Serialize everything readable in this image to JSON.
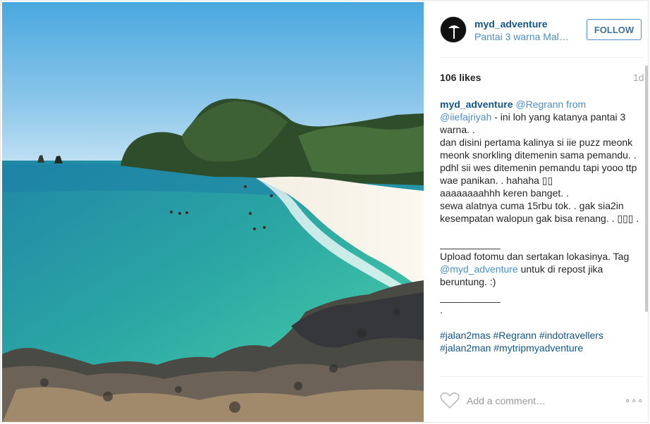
{
  "post": {
    "username": "myd_adventure",
    "location": "Pantai 3 warna Mal…",
    "follow_label": "FOLLOW",
    "likes": "106 likes",
    "time_ago": "1d",
    "caption_lines": [
      "@Regrann from",
      "@iiefajriyah",
      " - ini loh yang katanya pantai 3 warna. .",
      "dan disini pertama kalinya si iie puzz meonk meonk snorkling ditemenin sama pemandu. . pdhl sii wes ditemenin pemandu tapi yooo ttp wae panikan. . hahaha ▯▯",
      "aaaaaaaahhh keren banget. .",
      "sewa alatnya cuma 15rbu tok. . gak sia2in kesempatan walopun gak bisa renang. . ▯▯▯ .",
      "___________",
      "Upload fotomu dan sertakan lokasinya. Tag ",
      "@myd_adventure",
      " untuk di repost jika beruntung. :)",
      "___________",
      ".",
      "#jalan2mas #Regrann #indotravellers #jalan2man #mytripmyadventure"
    ],
    "comment_placeholder": "Add a comment…",
    "more_label": "∘∘∘"
  },
  "icons": {
    "heart": "heart-icon",
    "more": "more-options-icon"
  },
  "colors": {
    "link": "#125688",
    "mention": "#4a8fc7",
    "muted": "#a5a7aa"
  }
}
